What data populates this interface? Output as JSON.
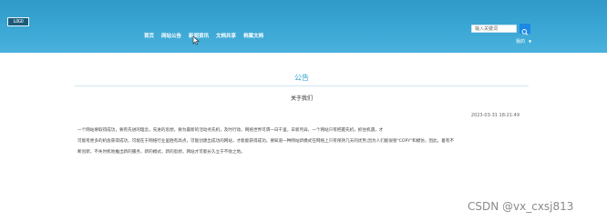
{
  "header": {
    "logo_text": "LOGO",
    "nav": [
      {
        "label": "首页"
      },
      {
        "label": "网站公告"
      },
      {
        "label": "新闻资讯"
      },
      {
        "label": "文档共享"
      },
      {
        "label": "档案文档"
      }
    ],
    "search": {
      "placeholder": "输入关键词"
    },
    "user_menu": {
      "label": "我的"
    },
    "accent": "#3aa6d4"
  },
  "main": {
    "section_title": "公告",
    "article": {
      "title": "关于我们",
      "date": "2023-03-31 18:21:49",
      "paragraphs": [
        "一个网站要取得成功，要有先进的理念，先进的思想，要为最新的活动点先机，及时行动，网络世界可谓一日千里，日新月异，一个网站只有把握先机，抓住机遇，才",
        "可能有更多的机会获得成功，可能在于网络行业里胜有高点，可能创建出成功的网站，才能能获得成功。要知道一种网站新模式在网络上只有保持几天的优势,因为人们能很替\"COPY\"和模仿，因此，着有不",
        "断创新，不失时机地推出新的服务，新的模式，新的思想，网站才可能长久立于不败之地。"
      ]
    }
  },
  "watermark": "CSDN @vx_cxsj813"
}
